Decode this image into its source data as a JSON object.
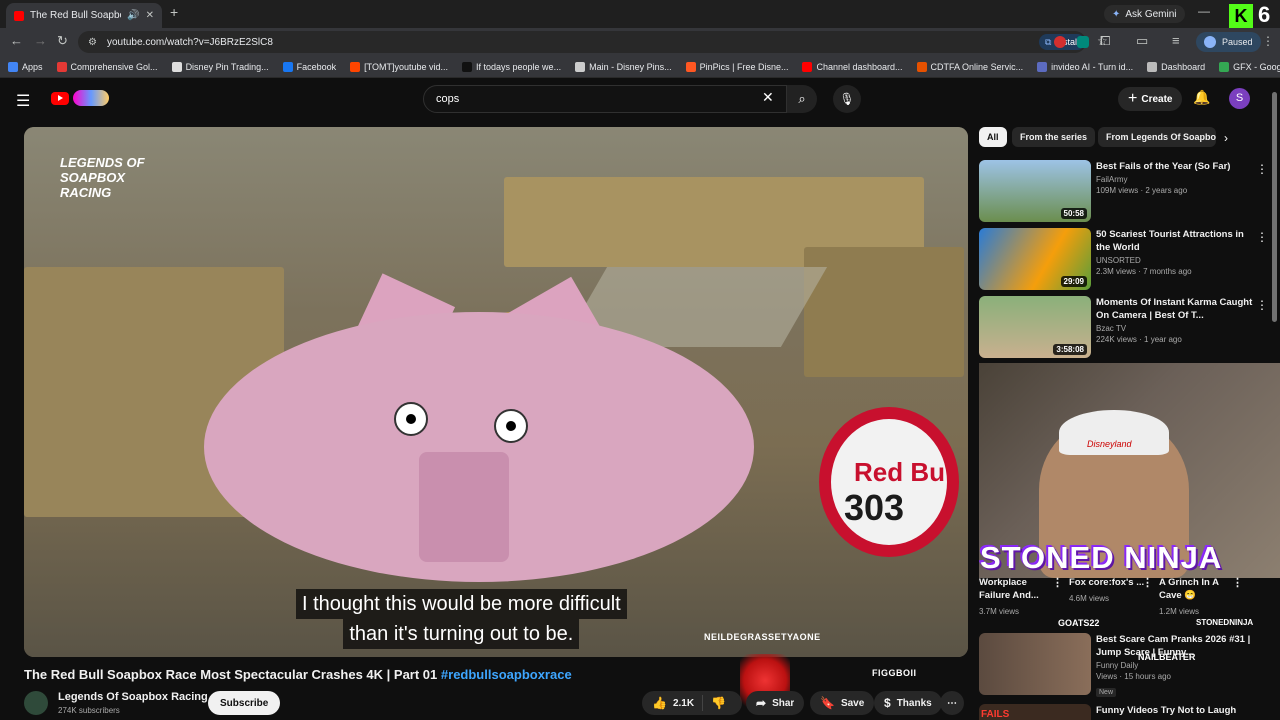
{
  "browser": {
    "tab_title": "The Red Bull Soapbox Race",
    "new_tab": "+",
    "ask_gemini": "Ask Gemini",
    "window_min": "—",
    "kick_logo": "K",
    "kick_count": "6",
    "url": "youtube.com/watch?v=J6BRzE2SlC8",
    "install_label": "Install",
    "paused_label": "Paused",
    "bookmarks": [
      {
        "label": "Apps",
        "color": "#4285f4"
      },
      {
        "label": "Comprehensive Gol...",
        "color": "#e53935"
      },
      {
        "label": "Disney Pin Trading...",
        "color": "#dddddd"
      },
      {
        "label": "Facebook",
        "color": "#1877f2"
      },
      {
        "label": "[TOMT]youtube vid...",
        "color": "#ff4500"
      },
      {
        "label": "If todays people we...",
        "color": "#111111"
      },
      {
        "label": "Main - Disney Pins...",
        "color": "#cccccc"
      },
      {
        "label": "PinPics | Free Disne...",
        "color": "#ff5722"
      },
      {
        "label": "Channel dashboard...",
        "color": "#ff0000"
      },
      {
        "label": "CDTFA Online Servic...",
        "color": "#e65100"
      },
      {
        "label": "invideo AI - Turn id...",
        "color": "#5c6bc0"
      },
      {
        "label": "Dashboard",
        "color": "#bbbbbb"
      },
      {
        "label": "GFX - Google Drive",
        "color": "#34a853"
      }
    ]
  },
  "youtube": {
    "search_query": "cops",
    "create_label": "Create",
    "avatar_letter": "S",
    "video": {
      "overlay_logo": "LEGENDS OF SOAPBOX RACING",
      "sign_text": "Red Bu",
      "sign_number": "303",
      "subtitle_line1": "I thought this would be more difficult",
      "subtitle_line2": "than it's turning out to be.",
      "watermark": "NEILDEGRASSETYAONE",
      "title": "The Red Bull Soapbox Race Most Spectacular Crashes 4K | Part 01",
      "hashtag": "#redbullsoapboxrace",
      "channel": "Legends Of Soapbox Racing",
      "subscribers": "274K subscribers",
      "subscribe_label": "Subscribe",
      "likes": "2.1K",
      "share_label": "Share",
      "save_label": "Save",
      "thanks_label": "Thanks",
      "overlay_name": "FIGGBOII"
    },
    "chips": [
      "All",
      "From the series",
      "From Legends Of Soapbo"
    ],
    "sidebar_videos": [
      {
        "title": "Best Fails of the Year (So Far)",
        "channel": "FailArmy",
        "meta": "109M views · 2 years ago",
        "duration": "50:58"
      },
      {
        "title": "50 Scariest Tourist Attractions in the World",
        "channel": "UNSORTED",
        "meta": "2.3M views · 7 months ago",
        "duration": "29:09"
      },
      {
        "title": "Moments Of Instant Karma Caught On Camera | Best Of T...",
        "channel": "Bzac TV",
        "meta": "224K views · 1 year ago",
        "duration": "3:58:08"
      }
    ],
    "shorts": [
      {
        "title": "Workplace Failure And...",
        "views": "3.7M views"
      },
      {
        "title": "Fox core:fox's ...",
        "views": "4.6M views"
      },
      {
        "title": "A Grinch In A Cave 😁",
        "views": "1.2M views"
      }
    ],
    "scare_video": {
      "title": "Best Scare Cam Pranks 2026 #31 | Jump Scare | Funny...",
      "channel": "Funny Daily",
      "meta": "Views · 15 hours ago",
      "badge": "New"
    },
    "last_video_title": "Funny Videos Try Not to Laugh",
    "last_thumb_text": "FAILS"
  },
  "stream_overlay": {
    "ninja_text": "STONED NINJA",
    "cap_text": "Disneyland",
    "goats": "GOATS22",
    "stonedninja": "STONEDNINJA",
    "nailbeater": "NAILBEATER"
  }
}
